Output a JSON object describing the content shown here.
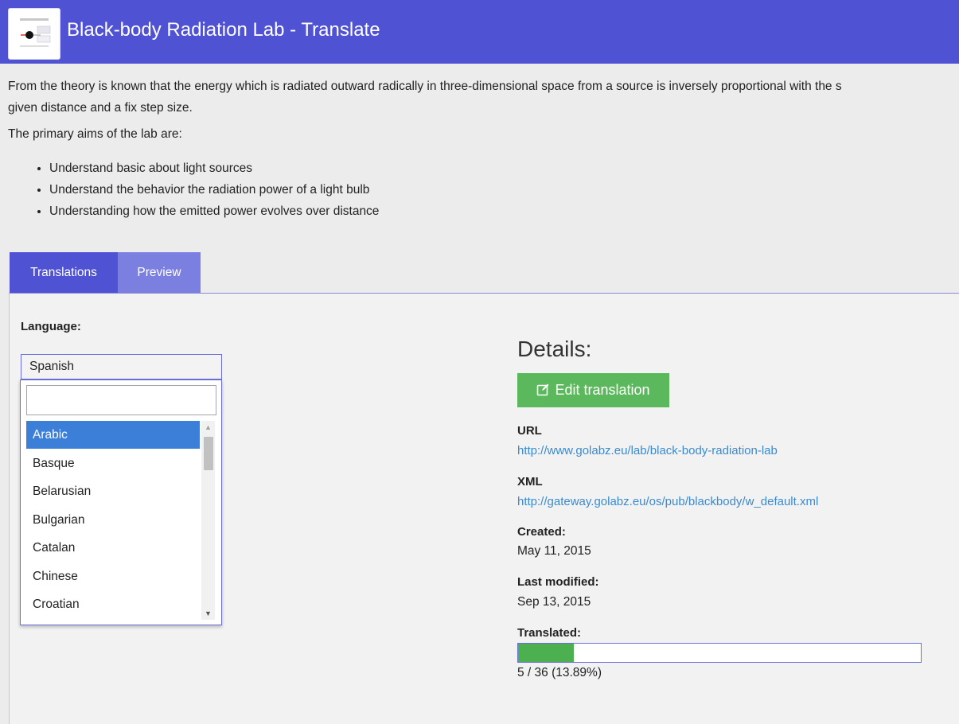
{
  "header": {
    "title": "Black-body Radiation Lab - Translate",
    "background_color": "#4f52d3",
    "logo_icon": "lab-thumbnail-icon"
  },
  "intro": {
    "line1": "From the theory is known that the energy which is radiated outward radically in three-dimensional space from a source is inversely proportional with the s",
    "line2": "given distance and a fix step size.",
    "aims_heading": "The primary aims of the lab are:",
    "aims": [
      "Understand basic about light sources",
      "Understand the behavior the radiation power of a light bulb",
      "Understanding how the emitted power evolves over distance"
    ]
  },
  "tabs": [
    {
      "label": "Translations",
      "active": true
    },
    {
      "label": "Preview",
      "active": false
    }
  ],
  "language": {
    "label": "Language:",
    "selected": "Spanish",
    "search_value": "",
    "options": [
      "Arabic",
      "Basque",
      "Belarusian",
      "Bulgarian",
      "Catalan",
      "Chinese",
      "Croatian"
    ],
    "highlighted": "Arabic"
  },
  "details": {
    "title": "Details:",
    "edit_button": "Edit translation",
    "edit_icon": "edit-icon",
    "url_label": "URL",
    "url": "http://www.golabz.eu/lab/black-body-radiation-lab",
    "xml_label": "XML",
    "xml": "http://gateway.golabz.eu/os/pub/blackbody/w_default.xml",
    "created_label": "Created:",
    "created": "May 11, 2015",
    "modified_label": "Last modified:",
    "modified": "Sep 13, 2015",
    "translated_label": "Translated:",
    "translated_fraction": 0.1389,
    "translated_text": "5 / 36 (13.89%)"
  },
  "colors": {
    "accent": "#4f52d3",
    "tab_inactive": "#7b7fe0",
    "success": "#5cb85c",
    "link": "#3a8ad0",
    "selected_option": "#3c7fd9"
  }
}
